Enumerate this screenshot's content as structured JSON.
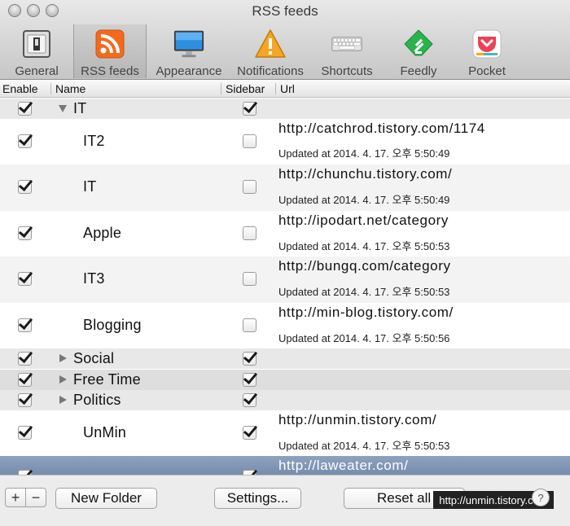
{
  "window": {
    "title": "RSS feeds"
  },
  "toolbar": {
    "tabs": [
      {
        "label": "General",
        "icon": "switch-icon",
        "selected": false
      },
      {
        "label": "RSS feeds",
        "icon": "rss-icon",
        "selected": true
      },
      {
        "label": "Appearance",
        "icon": "monitor-icon",
        "selected": false
      },
      {
        "label": "Notifications",
        "icon": "warning-icon",
        "selected": false
      },
      {
        "label": "Shortcuts",
        "icon": "keyboard-icon",
        "selected": false
      },
      {
        "label": "Feedly",
        "icon": "feedly-icon",
        "selected": false
      },
      {
        "label": "Pocket",
        "icon": "pocket-icon",
        "selected": false
      }
    ]
  },
  "table": {
    "columns": {
      "enable": "Enable",
      "name": "Name",
      "sidebar": "Sidebar",
      "url": "Url"
    },
    "rows": [
      {
        "type": "group",
        "name": "IT",
        "enabled": true,
        "sidebar": true,
        "expanded": true
      },
      {
        "type": "feed",
        "name": "IT2",
        "enabled": true,
        "sidebar": false,
        "url": "http://catchrod.tistory.com/1174",
        "updated": "Updated at 2014. 4. 17. 오후 5:50:49"
      },
      {
        "type": "feed",
        "name": "IT",
        "enabled": true,
        "sidebar": false,
        "url": "http://chunchu.tistory.com/",
        "updated": "Updated at 2014. 4. 17. 오후 5:50:49"
      },
      {
        "type": "feed",
        "name": "Apple",
        "enabled": true,
        "sidebar": false,
        "url": "http://ipodart.net/category",
        "updated": "Updated at 2014. 4. 17. 오후 5:50:53"
      },
      {
        "type": "feed",
        "name": "IT3",
        "enabled": true,
        "sidebar": false,
        "url": "http://bungq.com/category",
        "updated": "Updated at 2014. 4. 17. 오후 5:50:53"
      },
      {
        "type": "feed",
        "name": "Blogging",
        "enabled": true,
        "sidebar": false,
        "url": "http://min-blog.tistory.com/",
        "updated": "Updated at 2014. 4. 17. 오후 5:50:56"
      },
      {
        "type": "group",
        "name": "Social",
        "enabled": true,
        "sidebar": true,
        "expanded": false
      },
      {
        "type": "group",
        "name": "Free Time",
        "enabled": true,
        "sidebar": true,
        "expanded": false
      },
      {
        "type": "group",
        "name": "Politics",
        "enabled": true,
        "sidebar": true,
        "expanded": false
      },
      {
        "type": "feed",
        "name": "UnMin",
        "enabled": true,
        "sidebar": true,
        "url": "http://unmin.tistory.com/",
        "updated": "Updated at 2014. 4. 17. 오후 5:50:53"
      },
      {
        "type": "feed",
        "name": "",
        "enabled": true,
        "sidebar": true,
        "url": "http://laweater.com/",
        "updated": "",
        "selected": true
      }
    ]
  },
  "bottom": {
    "add_label": "+",
    "remove_label": "−",
    "new_folder_label": "New Folder",
    "settings_label": "Settings...",
    "reset_label": "Reset all",
    "watermark": "http://unmin.tistory.com",
    "help_label": "?"
  },
  "colors": {
    "selection": "#7d91b1",
    "group_row": "#e8e8e8",
    "rss_orange": "#f26b1d",
    "feedly_green": "#2bb24c",
    "pocket_red": "#ee4056"
  }
}
